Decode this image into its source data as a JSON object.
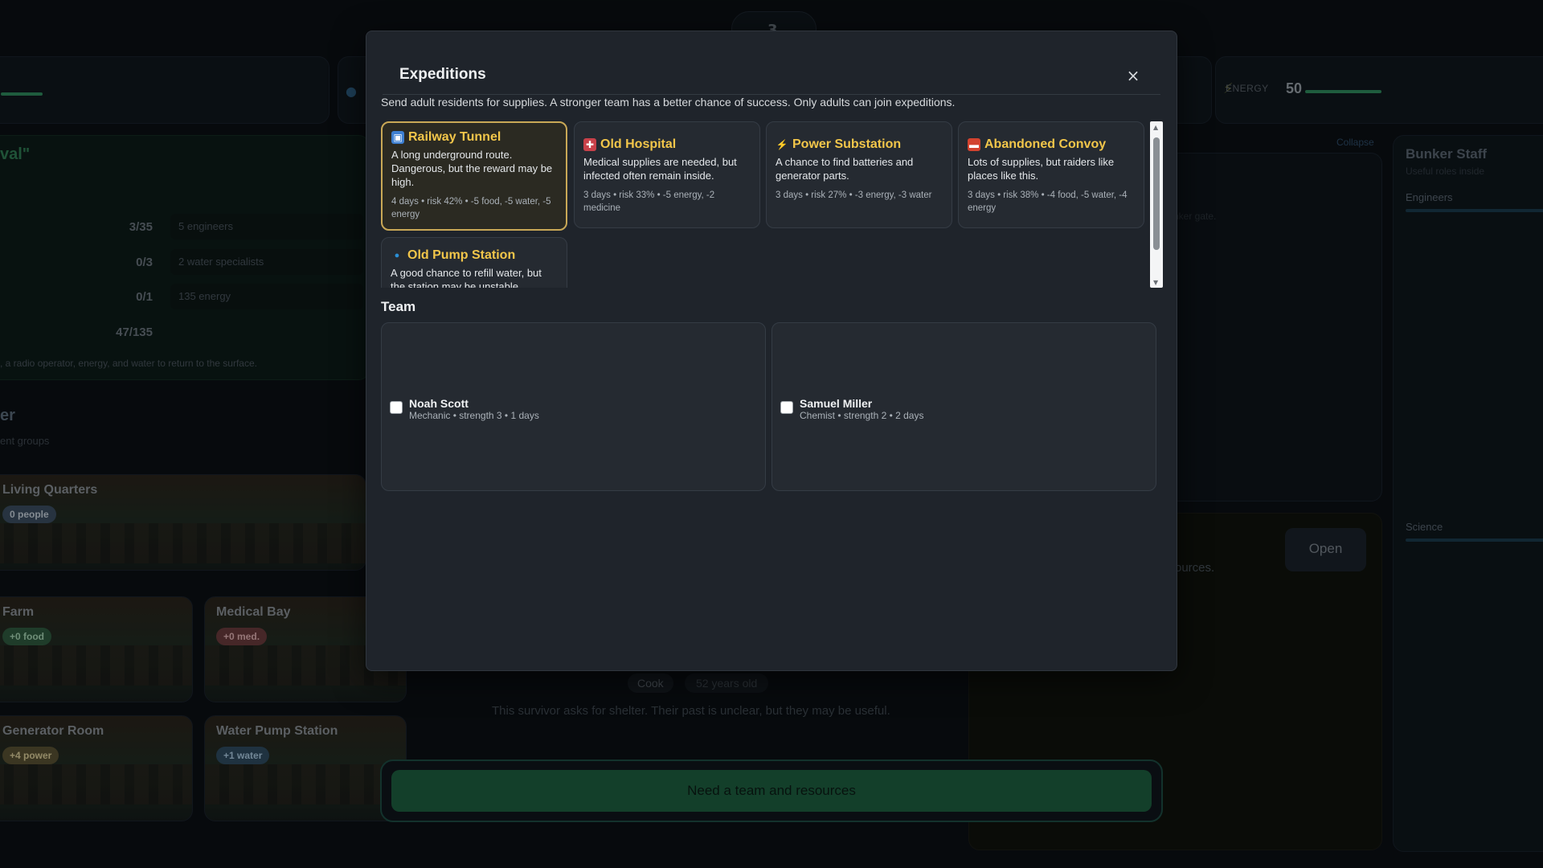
{
  "background": {
    "top_center_value": "3",
    "energy": {
      "label": "ENERGY",
      "value": "50"
    },
    "left_panel": {
      "title": "val\"",
      "rows": [
        {
          "value": "3/35",
          "need": "5 engineers"
        },
        {
          "value": "0/3",
          "need": "2 water specialists"
        },
        {
          "value": "0/1",
          "need": "135 energy"
        },
        {
          "value": "47/135",
          "need": ""
        }
      ],
      "footnote": ", a radio operator, energy, and water to return to the surface."
    },
    "shelter": {
      "title": "er",
      "subtitle": "ent groups"
    },
    "rooms": [
      {
        "name": "Living Quarters",
        "badge": "0 people"
      },
      {
        "name": "Farm",
        "badge": "+0 food"
      },
      {
        "name": "Medical Bay",
        "badge": "+0 med."
      },
      {
        "name": "Generator Room",
        "badge": "+4 power"
      },
      {
        "name": "Water Pump Station",
        "badge": "+1 water"
      }
    ],
    "survivor": {
      "role": "Cook",
      "age": "52 years old",
      "description": "This survivor asks for shelter. Their past is unclear, but they may be useful."
    },
    "right": {
      "collapse": "Collapse",
      "gate_text": "nker gate.",
      "resources_text": "ources.",
      "open_button": "Open"
    },
    "staff": {
      "title": "Bunker Staff",
      "subtitle": "Useful roles inside",
      "roles": [
        "Engineers",
        "Science"
      ]
    },
    "bottom_button": "Need a team and resources"
  },
  "modal": {
    "title": "Expeditions",
    "close_glyph": "×",
    "description": "Send adult residents for supplies. A stronger team has a better chance of success. Only adults can join expeditions.",
    "expeditions": [
      {
        "icon": "train-icon",
        "icon_glyph": "▣",
        "icon_color": "#3d7fd1",
        "name": "Railway Tunnel",
        "description": "A long underground route. Dangerous, but the reward may be high.",
        "meta": "4 days • risk 42% • -5 food, -5 water, -5 energy",
        "selected": true
      },
      {
        "icon": "hospital-icon",
        "icon_glyph": "✚",
        "icon_color": "#c8414a",
        "name": "Old Hospital",
        "description": "Medical supplies are needed, but infected often remain inside.",
        "meta": "3 days • risk 33% • -5 energy, -2 medicine",
        "selected": false
      },
      {
        "icon": "lightning-icon",
        "icon_glyph": "⚡",
        "icon_color": "#e8b320",
        "name": "Power Substation",
        "description": "A chance to find batteries and generator parts.",
        "meta": "3 days • risk 27% • -3 energy, -3 water",
        "selected": false
      },
      {
        "icon": "truck-icon",
        "icon_glyph": "▬",
        "icon_color": "#d2432f",
        "name": "Abandoned Convoy",
        "description": "Lots of supplies, but raiders like places like this.",
        "meta": "3 days • risk 38% • -4 food, -5 water, -4 energy",
        "selected": false
      },
      {
        "icon": "water-drop-icon",
        "icon_glyph": "💧",
        "icon_color": "#2a8fd6",
        "name": "Old Pump Station",
        "description": "A good chance to refill water, but the station may be unstable.",
        "meta": "",
        "selected": false
      }
    ],
    "team_label": "Team",
    "team": [
      {
        "name": "Noah Scott",
        "info": "Mechanic • strength 3 • 1 days",
        "checked": false
      },
      {
        "name": "Samuel Miller",
        "info": "Chemist • strength 2 • 2 days",
        "checked": false
      }
    ]
  },
  "colors": {
    "accent_gold": "#f2c64a",
    "selected_border": "#c9a856",
    "modal_bg": "#1f242b",
    "action_green": "#1c5e3d"
  }
}
